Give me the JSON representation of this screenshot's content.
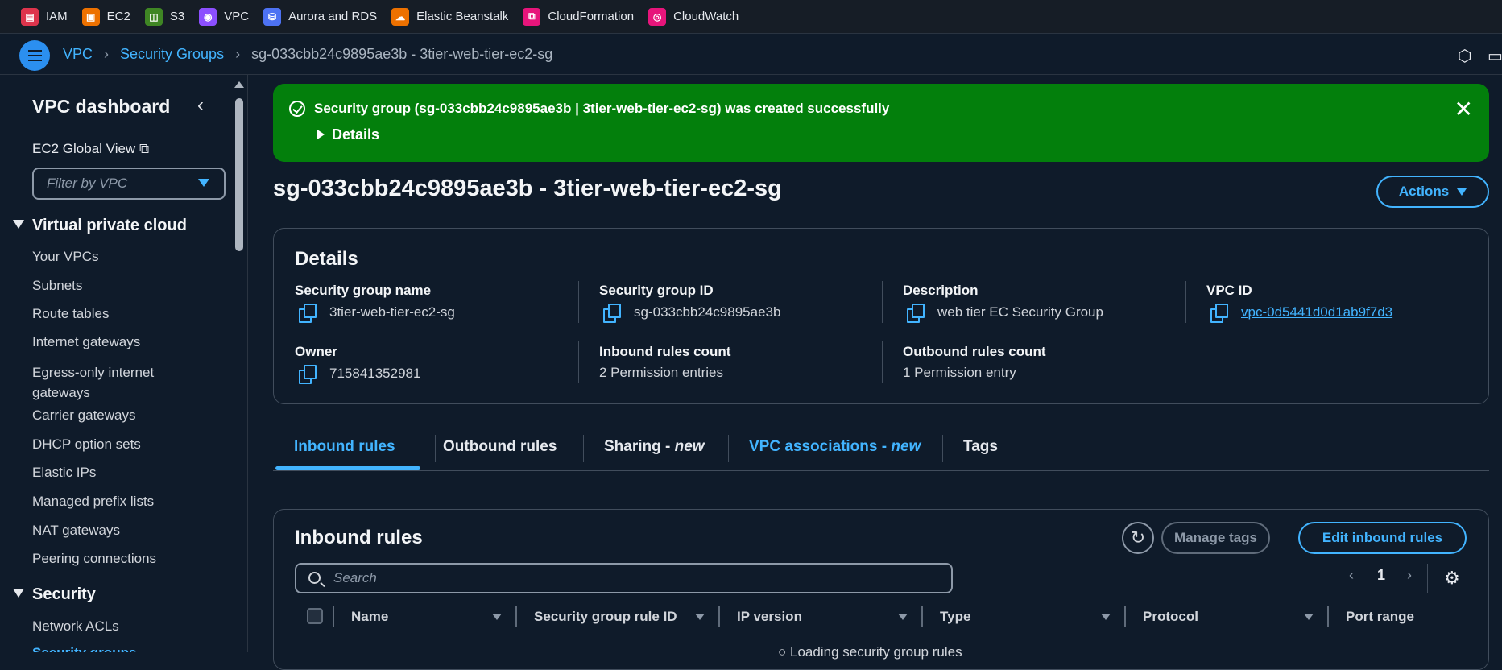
{
  "services": [
    {
      "label": "IAM",
      "color": "#dd344c",
      "glyph": "▤"
    },
    {
      "label": "EC2",
      "color": "#ed7100",
      "glyph": "▣"
    },
    {
      "label": "S3",
      "color": "#3f8624",
      "glyph": "◫"
    },
    {
      "label": "VPC",
      "color": "#8c4fff",
      "glyph": "◉"
    },
    {
      "label": "Aurora and RDS",
      "color": "#4d72f3",
      "glyph": "⛁"
    },
    {
      "label": "Elastic Beanstalk",
      "color": "#ed7100",
      "glyph": "☁"
    },
    {
      "label": "CloudFormation",
      "color": "#e7157b",
      "glyph": "⧉"
    },
    {
      "label": "CloudWatch",
      "color": "#e7157b",
      "glyph": "◎"
    }
  ],
  "breadcrumb": {
    "vpc": "VPC",
    "sg": "Security Groups",
    "current": "sg-033cbb24c9895ae3b - 3tier-web-tier-ec2-sg"
  },
  "sidebar": {
    "title": "VPC dashboard",
    "global_view": "EC2 Global View",
    "filter_placeholder": "Filter by VPC",
    "section_vpc": "Virtual private cloud",
    "vpc_items": [
      "Your VPCs",
      "Subnets",
      "Route tables",
      "Internet gateways",
      "Egress-only internet gateways",
      "Carrier gateways",
      "DHCP option sets",
      "Elastic IPs",
      "Managed prefix lists",
      "NAT gateways",
      "Peering connections"
    ],
    "section_security": "Security",
    "security_items": [
      "Network ACLs",
      "Security groups"
    ]
  },
  "flash": {
    "prefix": "Security group (",
    "link": "sg-033cbb24c9895ae3b | 3tier-web-tier-ec2-sg",
    "suffix": ") was created successfully",
    "details": "Details",
    "close": "✕"
  },
  "page": {
    "title": "sg-033cbb24c9895ae3b - 3tier-web-tier-ec2-sg",
    "actions": "Actions"
  },
  "details": {
    "heading": "Details",
    "sg_name_label": "Security group name",
    "sg_name": "3tier-web-tier-ec2-sg",
    "sg_id_label": "Security group ID",
    "sg_id": "sg-033cbb24c9895ae3b",
    "desc_label": "Description",
    "desc": "web tier EC Security Group",
    "vpc_label": "VPC ID",
    "vpc_id": "vpc-0d5441d0d1ab9f7d3",
    "owner_label": "Owner",
    "owner": "715841352981",
    "inbound_label": "Inbound rules count",
    "inbound": "2 Permission entries",
    "outbound_label": "Outbound rules count",
    "outbound": "1 Permission entry"
  },
  "tabs": {
    "inbound": "Inbound rules",
    "outbound": "Outbound rules",
    "sharing": "Sharing - ",
    "sharing_new": "new",
    "vpc_assoc": "VPC associations - ",
    "vpc_assoc_new": "new",
    "tags": "Tags"
  },
  "rules": {
    "heading": "Inbound rules",
    "manage_tags": "Manage tags",
    "edit": "Edit inbound rules",
    "search_placeholder": "Search",
    "page": "1",
    "columns": [
      "Name",
      "Security group rule ID",
      "IP version",
      "Type",
      "Protocol",
      "Port range"
    ],
    "loading": "Loading security group rules"
  }
}
